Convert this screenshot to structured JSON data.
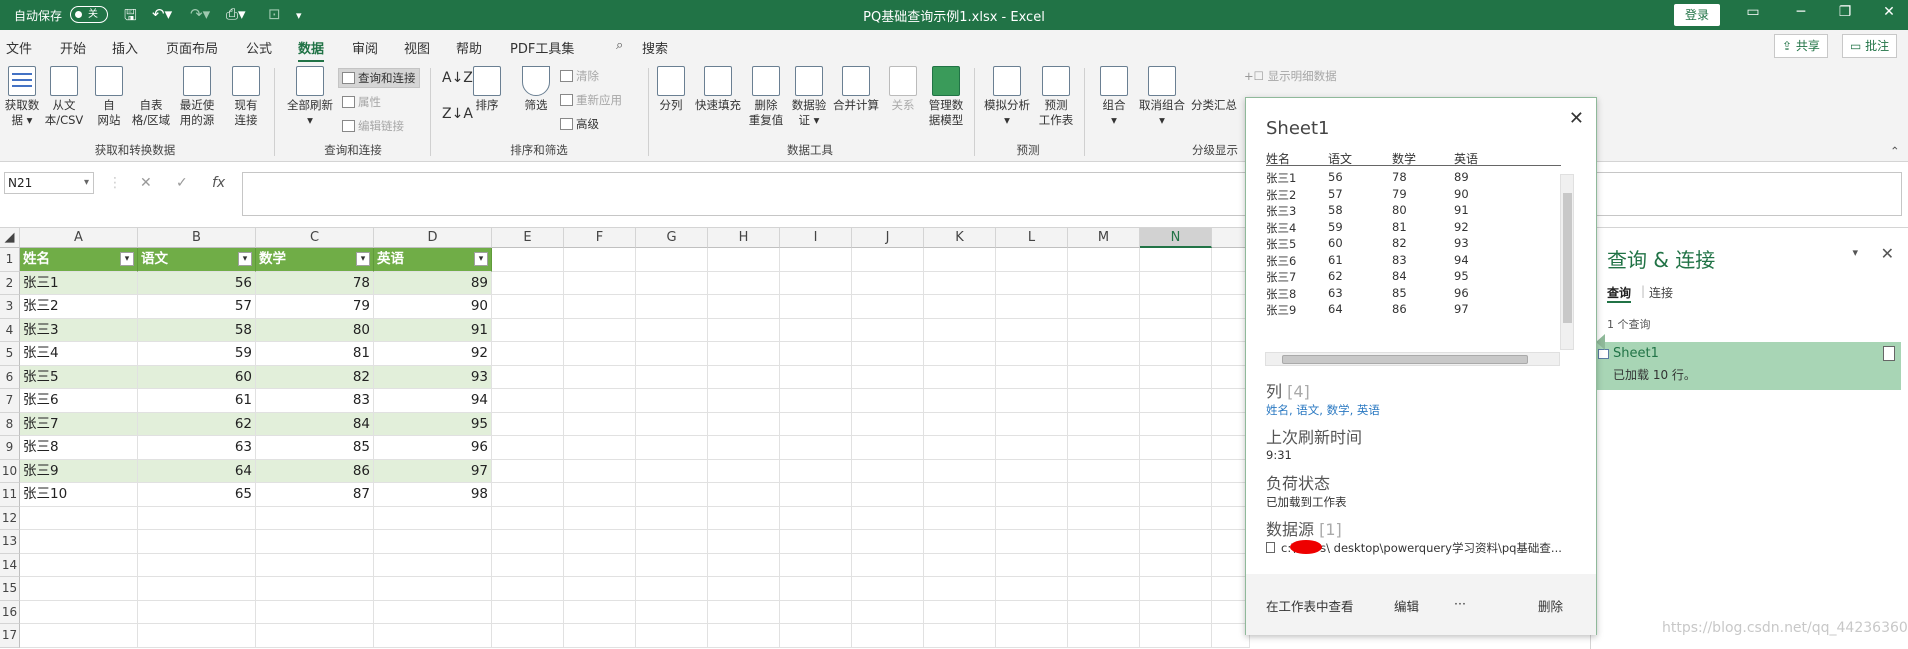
{
  "titlebar": {
    "autosave": "自动保存",
    "toggle": "关",
    "title": "PQ基础查询示例1.xlsx  -  Excel",
    "login": "登录"
  },
  "menu": {
    "tabs": [
      "文件",
      "开始",
      "插入",
      "页面布局",
      "公式",
      "数据",
      "审阅",
      "视图",
      "帮助",
      "PDF工具集"
    ],
    "search": "搜索",
    "share": "共享",
    "comment": "批注"
  },
  "ribbon": {
    "get_data": "获取数\n据 ▾",
    "from_csv": "从文\n本/CSV",
    "from_web": "自\n网站",
    "from_table": "自表\n格/区域",
    "recent": "最近使\n用的源",
    "existing": "现有\n连接",
    "refresh_all": "全部刷新\n▾",
    "queries_conn": "查询和连接",
    "properties": "属性",
    "edit_links": "编辑链接",
    "sort": "排序",
    "filter": "筛选",
    "clear": "清除",
    "reapply": "重新应用",
    "advanced": "高级",
    "split": "分列",
    "flash_fill": "快速填充",
    "remove_dup": "删除\n重复值",
    "validation": "数据验\n证 ▾",
    "consolidate": "合并计算",
    "relations": "关系",
    "manage_model": "管理数\n据模型",
    "whatif": "模拟分析\n▾",
    "forecast": "预测\n工作表",
    "group": "组合\n▾",
    "ungroup": "取消组合\n▾",
    "subtotal": "分类汇总",
    "show_detail": "显示明细数据",
    "groups": {
      "get": "获取和转换数据",
      "queries": "查询和连接",
      "sortfilter": "排序和筛选",
      "tools": "数据工具",
      "forecast": "预测",
      "outline": "分级显示"
    }
  },
  "formula": {
    "namebox": "N21",
    "fx": "fx",
    "cancel": "✕",
    "enter": "✓"
  },
  "sheet": {
    "columns": [
      "A",
      "B",
      "C",
      "D",
      "E",
      "F",
      "G",
      "H",
      "I",
      "J",
      "K",
      "L",
      "M",
      "N"
    ],
    "selected_col": "N",
    "headers": [
      "姓名",
      "语文",
      "数学",
      "英语"
    ],
    "rows": [
      [
        "张三1",
        "56",
        "78",
        "89"
      ],
      [
        "张三2",
        "57",
        "79",
        "90"
      ],
      [
        "张三3",
        "58",
        "80",
        "91"
      ],
      [
        "张三4",
        "59",
        "81",
        "92"
      ],
      [
        "张三5",
        "60",
        "82",
        "93"
      ],
      [
        "张三6",
        "61",
        "83",
        "94"
      ],
      [
        "张三7",
        "62",
        "84",
        "95"
      ],
      [
        "张三8",
        "63",
        "85",
        "96"
      ],
      [
        "张三9",
        "64",
        "86",
        "97"
      ],
      [
        "张三10",
        "65",
        "87",
        "98"
      ]
    ],
    "row_numbers": [
      "1",
      "2",
      "3",
      "4",
      "5",
      "6",
      "7",
      "8",
      "9",
      "10",
      "11",
      "12",
      "13",
      "14",
      "15",
      "16",
      "17"
    ]
  },
  "popup": {
    "title": "Sheet1",
    "columns": [
      "姓名",
      "语文",
      "数学",
      "英语"
    ],
    "rows": [
      [
        "张三1",
        "56",
        "78",
        "89"
      ],
      [
        "张三2",
        "57",
        "79",
        "90"
      ],
      [
        "张三3",
        "58",
        "80",
        "91"
      ],
      [
        "张三4",
        "59",
        "81",
        "92"
      ],
      [
        "张三5",
        "60",
        "82",
        "93"
      ],
      [
        "张三6",
        "61",
        "83",
        "94"
      ],
      [
        "张三7",
        "62",
        "84",
        "95"
      ],
      [
        "张三8",
        "63",
        "85",
        "96"
      ],
      [
        "张三9",
        "64",
        "86",
        "97"
      ]
    ],
    "col_label": "列",
    "col_count": "[4]",
    "col_list": "姓名, 语文, 数学, 英语",
    "refresh_label": "上次刷新时间",
    "refresh_value": "9:31",
    "load_label": "负荷状态",
    "load_value": "已加载到工作表",
    "source_label": "数据源",
    "source_count": "[1]",
    "source_value": "c:\\users\\       desktop\\powerquery学习资料\\pq基础查...",
    "view_in_sheet": "在工作表中查看",
    "edit": "编辑",
    "more": "···",
    "delete": "删除"
  },
  "query_pane": {
    "title": "查询 & 连接",
    "tab_queries": "查询",
    "tab_connections": "连接",
    "count": "1 个查询",
    "item_name": "Sheet1",
    "item_status": "已加载 10 行。"
  },
  "watermark": "https://blog.csdn.net/qq_44236360"
}
